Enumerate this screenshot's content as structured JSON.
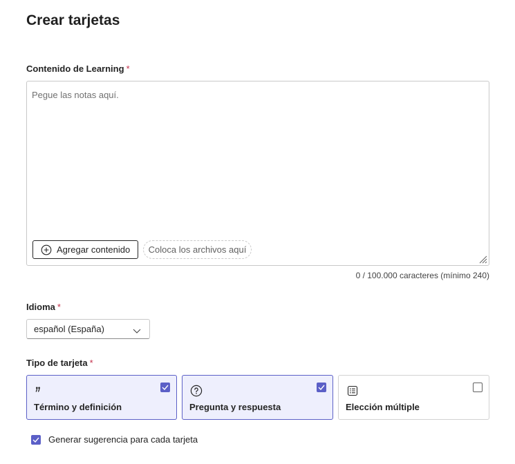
{
  "title": "Crear tarjetas",
  "content": {
    "label": "Contenido de Learning",
    "required_mark": "*",
    "placeholder": "Pegue las notas aquí.",
    "value": "",
    "add_button_label": "Agregar contenido",
    "drop_zone_label": "Coloca los archivos aquí",
    "char_count": "0 / 100.000 caracteres (mínimo 240)"
  },
  "language": {
    "label": "Idioma",
    "required_mark": "*",
    "selected": "español (España)"
  },
  "card_type": {
    "label": "Tipo de tarjeta",
    "required_mark": "*",
    "options": [
      {
        "label": "Término y definición",
        "icon": "quote-icon",
        "checked": true
      },
      {
        "label": "Pregunta y respuesta",
        "icon": "question-circle-icon",
        "checked": true
      },
      {
        "label": "Elección múltiple",
        "icon": "list-icon",
        "checked": false
      }
    ]
  },
  "hint_option": {
    "label": "Generar sugerencia para cada tarjeta",
    "checked": true
  },
  "colors": {
    "accent": "#5b5fc7",
    "selected_bg": "#eeeffd",
    "required": "#c4314b"
  }
}
